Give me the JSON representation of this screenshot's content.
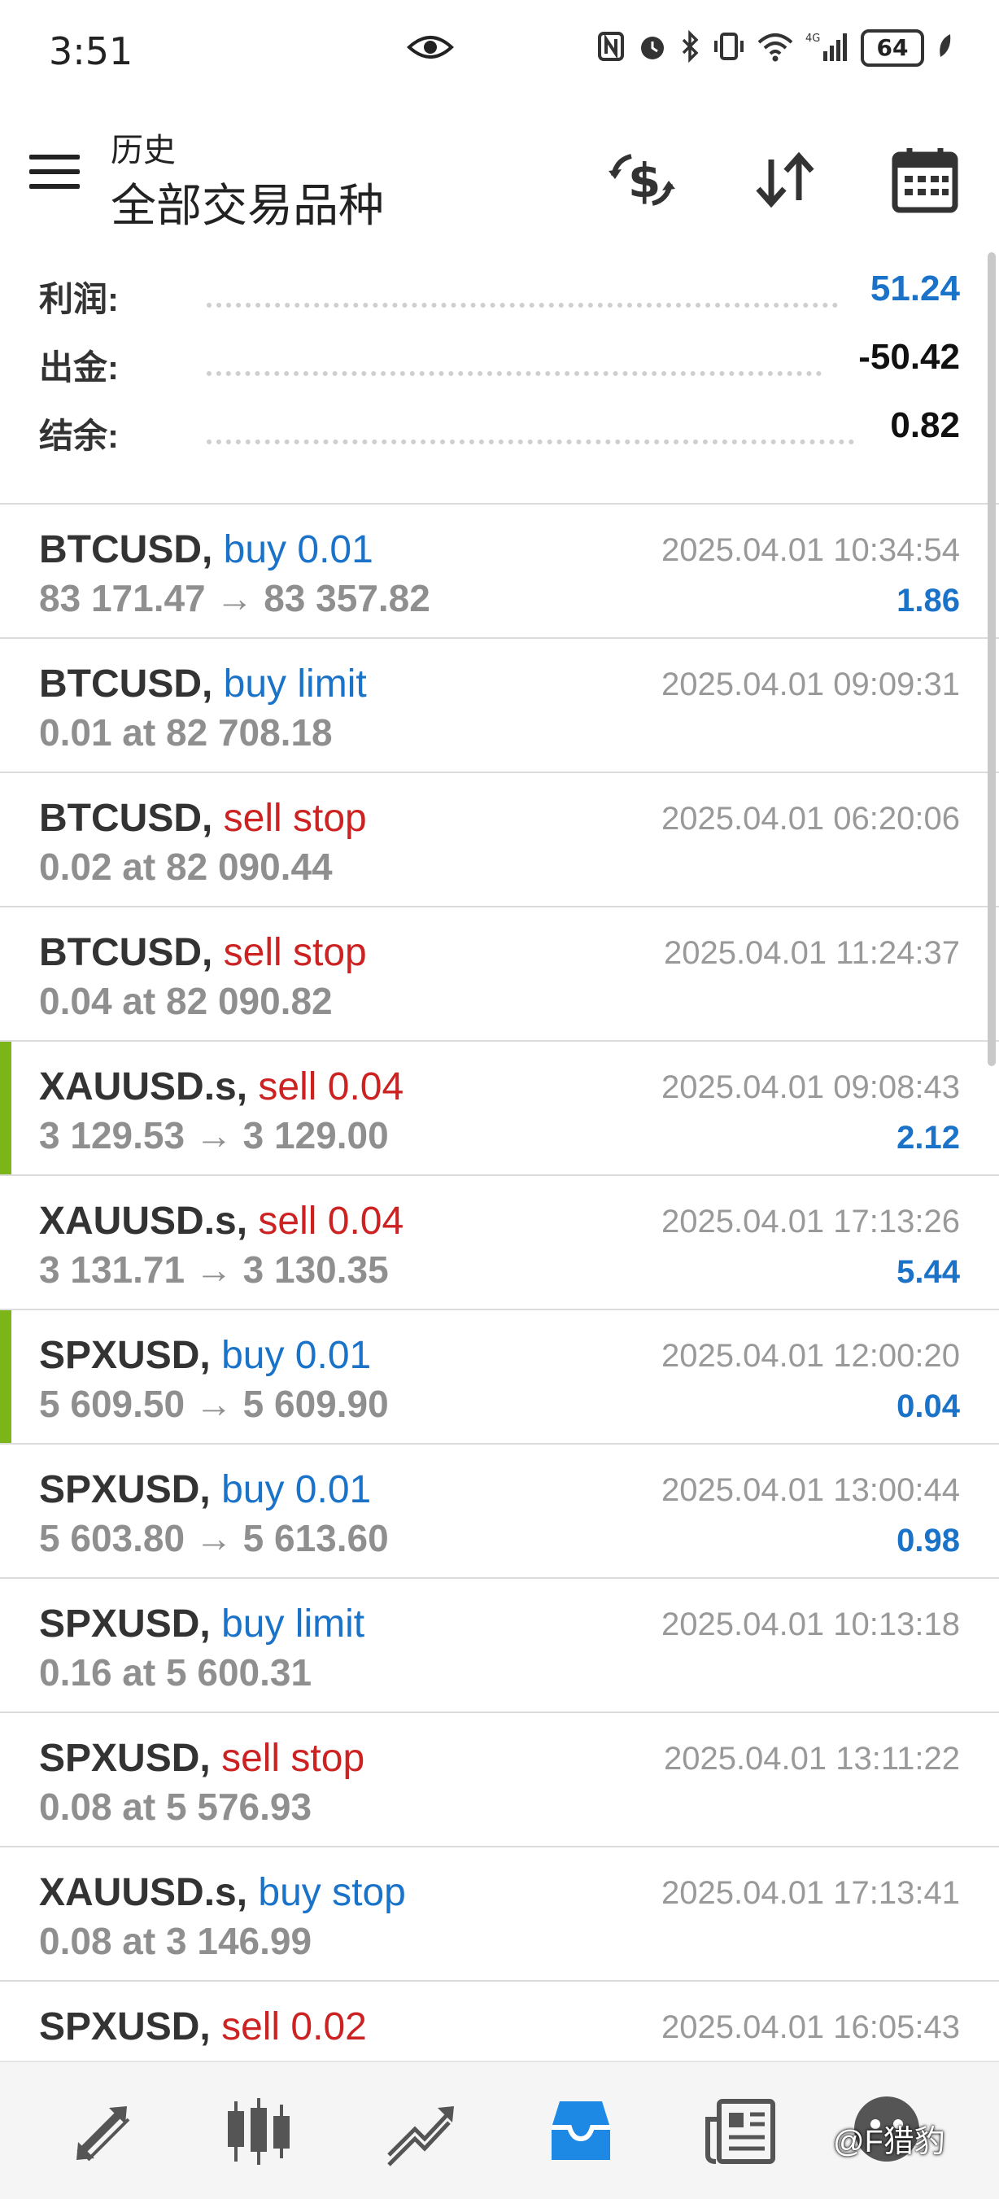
{
  "status_bar": {
    "time": "3:51",
    "battery": "64"
  },
  "header": {
    "subtitle": "历史",
    "title": "全部交易品种"
  },
  "summary": [
    {
      "label": "利润:",
      "value": "51.24",
      "color": "#1a73c9"
    },
    {
      "label": "出金:",
      "value": "-50.42",
      "color": "#111111"
    },
    {
      "label": "结余:",
      "value": "0.82",
      "color": "#111111"
    }
  ],
  "trades": [
    {
      "symbol": "BTCUSD,",
      "action": " buy 0.01",
      "side": "buy",
      "detail": "83 171.47 → 83 357.82",
      "time": "2025.04.01 10:34:54",
      "profit": "1.86",
      "marker": false
    },
    {
      "symbol": "BTCUSD,",
      "action": " buy limit",
      "side": "buy",
      "detail": "0.01 at 82 708.18",
      "time": "2025.04.01 09:09:31",
      "profit": "",
      "marker": false
    },
    {
      "symbol": "BTCUSD,",
      "action": " sell stop",
      "side": "sell",
      "detail": "0.02 at 82 090.44",
      "time": "2025.04.01 06:20:06",
      "profit": "",
      "marker": false
    },
    {
      "symbol": "BTCUSD,",
      "action": " sell stop",
      "side": "sell",
      "detail": "0.04 at 82 090.82",
      "time": "2025.04.01 11:24:37",
      "profit": "",
      "marker": false
    },
    {
      "symbol": "XAUUSD.s,",
      "action": " sell 0.04",
      "side": "sell",
      "detail": "3 129.53 → 3 129.00",
      "time": "2025.04.01 09:08:43",
      "profit": "2.12",
      "marker": true
    },
    {
      "symbol": "XAUUSD.s,",
      "action": " sell 0.04",
      "side": "sell",
      "detail": "3 131.71 → 3 130.35",
      "time": "2025.04.01 17:13:26",
      "profit": "5.44",
      "marker": false
    },
    {
      "symbol": "SPXUSD,",
      "action": " buy 0.01",
      "side": "buy",
      "detail": "5 609.50 → 5 609.90",
      "time": "2025.04.01 12:00:20",
      "profit": "0.04",
      "marker": true
    },
    {
      "symbol": "SPXUSD,",
      "action": " buy 0.01",
      "side": "buy",
      "detail": "5 603.80 → 5 613.60",
      "time": "2025.04.01 13:00:44",
      "profit": "0.98",
      "marker": false
    },
    {
      "symbol": "SPXUSD,",
      "action": " buy limit",
      "side": "buy",
      "detail": "0.16 at 5 600.31",
      "time": "2025.04.01 10:13:18",
      "profit": "",
      "marker": false
    },
    {
      "symbol": "SPXUSD,",
      "action": " sell stop",
      "side": "sell",
      "detail": "0.08 at 5 576.93",
      "time": "2025.04.01 13:11:22",
      "profit": "",
      "marker": false
    },
    {
      "symbol": "XAUUSD.s,",
      "action": " buy stop",
      "side": "buy",
      "detail": "0.08 at 3 146.99",
      "time": "2025.04.01 17:13:41",
      "profit": "",
      "marker": false
    },
    {
      "symbol": "SPXUSD,",
      "action": " sell 0.02",
      "side": "sell",
      "detail": "",
      "time": "2025.04.01 16:05:43",
      "profit": "",
      "marker": false
    }
  ],
  "bottom_nav": [
    "quotes-icon",
    "chart-icon",
    "trade-icon",
    "history-icon",
    "news-icon",
    "messages-icon"
  ],
  "watermark": "@F猎豹"
}
